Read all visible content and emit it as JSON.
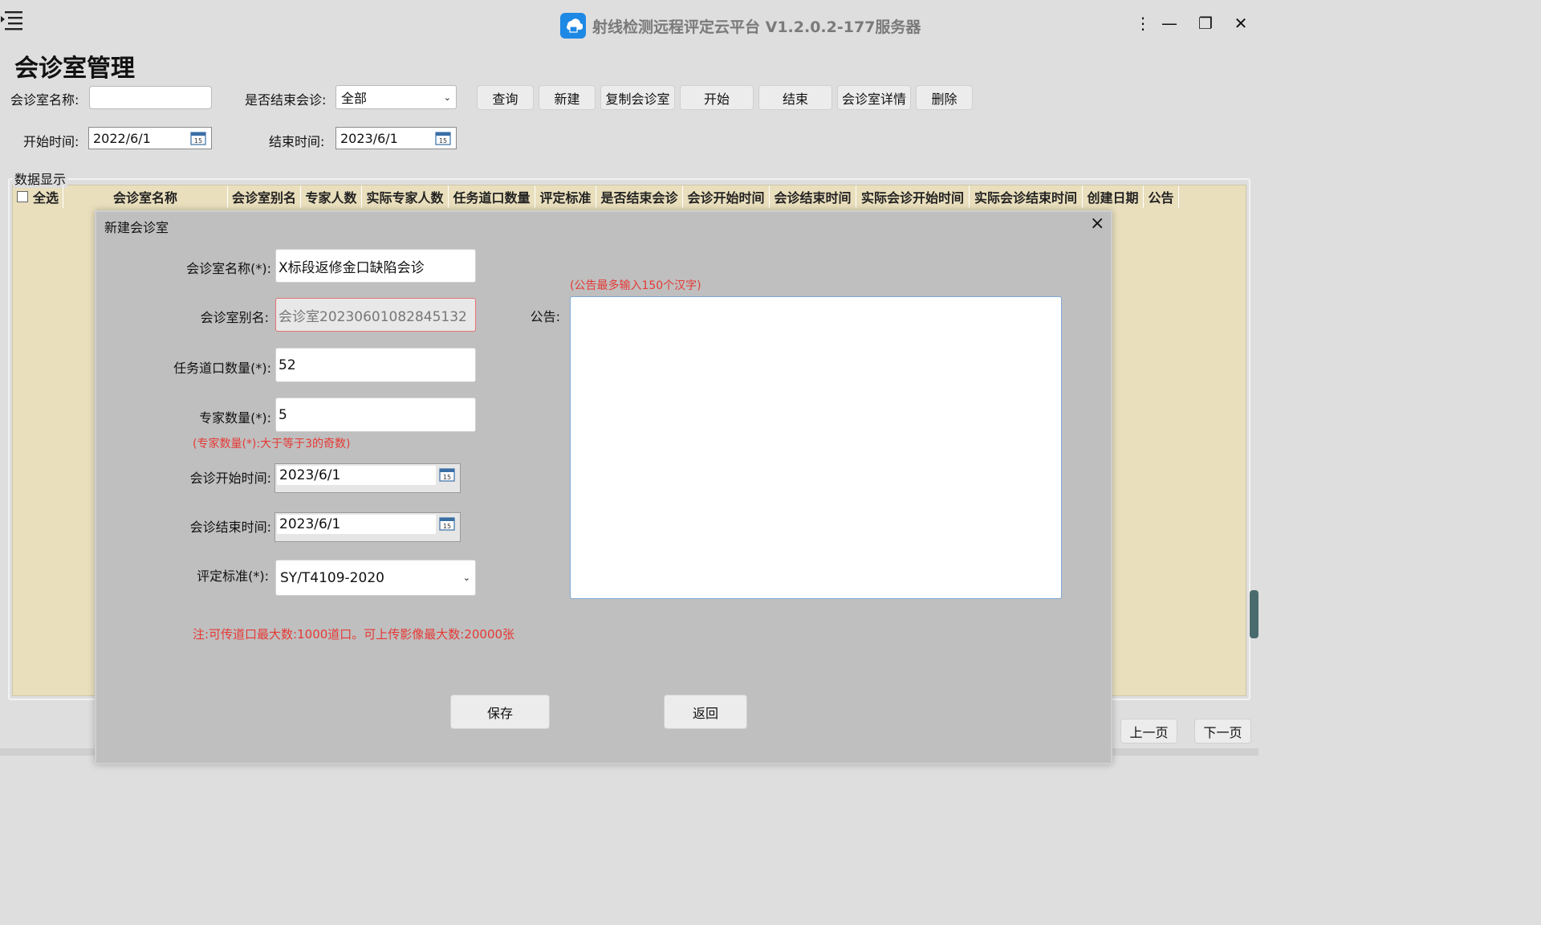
{
  "titlebar": {
    "title": "射线检测远程评定云平台 V1.2.0.2-177服务器",
    "more_glyph": "⋮",
    "min_glyph": "—",
    "restore_glyph": "❐",
    "close_glyph": "✕"
  },
  "page": {
    "title": "会诊室管理"
  },
  "filters": {
    "name_label": "会诊室名称:",
    "name_value": "",
    "ended_label": "是否结束会诊:",
    "ended_value": "全部",
    "start_label": "开始时间:",
    "start_value": "2022/6/1",
    "end_label": "结束时间:",
    "end_value": "2023/6/1",
    "calendar_day": "15"
  },
  "toolbar": {
    "query": "查询",
    "new": "新建",
    "copy": "复制会诊室",
    "start": "开始",
    "end": "结束",
    "detail": "会诊室详情",
    "delete": "删除"
  },
  "grid": {
    "group_label": "数据显示",
    "select_all": "全选",
    "columns": [
      "会诊室名称",
      "会诊室别名",
      "专家人数",
      "实际专家人数",
      "任务道口数量",
      "评定标准",
      "是否结束会诊",
      "会诊开始时间",
      "会诊结束时间",
      "实际会诊开始时间",
      "实际会诊结束时间",
      "创建日期",
      "公告"
    ]
  },
  "pager": {
    "prev": "上一页",
    "next": "下一页"
  },
  "modal": {
    "title": "新建会诊室",
    "close_glyph": "×",
    "name_label": "会诊室名称(*):",
    "name_value": "X标段返修金口缺陷会诊",
    "alias_label": "会诊室别名:",
    "alias_value": "会诊室20230601082845132",
    "ports_label": "任务道口数量(*):",
    "ports_value": "52",
    "experts_label": "专家数量(*):",
    "experts_value": "5",
    "experts_hint": "(专家数量(*):大于等于3的奇数)",
    "start_label": "会诊开始时间:",
    "start_value": "2023/6/1",
    "end_label": "会诊结束时间:",
    "end_value": "2023/6/1",
    "standard_label": "评定标准(*):",
    "standard_value": "SY/T4109-2020",
    "notice_hint": "(公告最多输入150个汉字)",
    "notice_label": "公告:",
    "notice_value": "",
    "note": "注:可传道口最大数:1000道口。可上传影像最大数:20000张",
    "save": "保存",
    "back": "返回"
  }
}
